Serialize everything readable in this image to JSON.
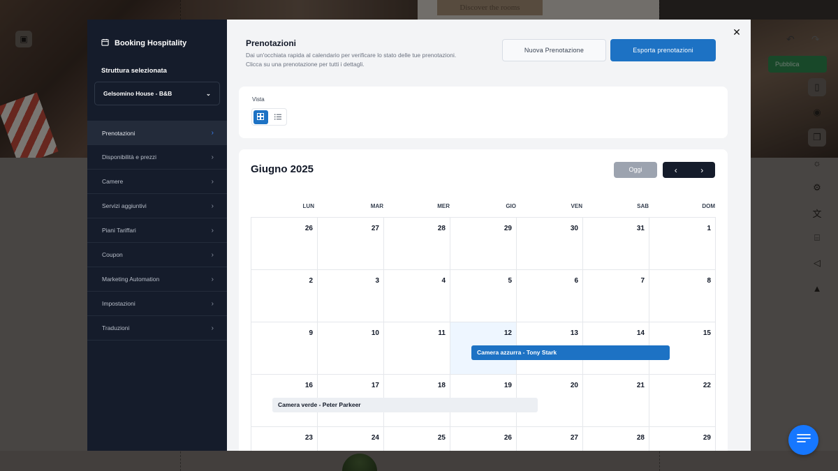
{
  "background": {
    "hero_cta": "Discover the rooms",
    "publish_label": "Pubblica"
  },
  "sidebar": {
    "title": "Booking Hospitality",
    "structure_label": "Struttura selezionata",
    "selected_property": "Gelsomino House - B&B",
    "items": [
      {
        "label": "Prenotazioni",
        "active": true
      },
      {
        "label": "Disponibilità e prezzi"
      },
      {
        "label": "Camere"
      },
      {
        "label": "Servizi aggiuntivi"
      },
      {
        "label": "Piani Tariffari"
      },
      {
        "label": "Coupon"
      },
      {
        "label": "Marketing Automation"
      },
      {
        "label": "Impostazioni"
      },
      {
        "label": "Traduzioni"
      }
    ]
  },
  "main": {
    "title": "Prenotazioni",
    "description_line1": "Dai un'occhiata rapida al calendario per verificare lo stato delle tue prenotazioni.",
    "description_line2": "Clicca su una prenotazione per tutti i dettagli.",
    "new_booking_label": "Nuova Prenotazione",
    "export_label": "Esporta prenotazioni"
  },
  "view": {
    "label": "Vista",
    "selected": "calendar"
  },
  "calendar": {
    "month_title": "Giugno 2025",
    "today_label": "Oggi",
    "weekdays": [
      "LUN",
      "MAR",
      "MER",
      "GIO",
      "VEN",
      "SAB",
      "DOM"
    ],
    "weeks": [
      [
        "26",
        "27",
        "28",
        "29",
        "30",
        "31",
        "1"
      ],
      [
        "2",
        "3",
        "4",
        "5",
        "6",
        "7",
        "8"
      ],
      [
        "9",
        "10",
        "11",
        "12",
        "13",
        "14",
        "15"
      ],
      [
        "16",
        "17",
        "18",
        "19",
        "20",
        "21",
        "22"
      ],
      [
        "23",
        "24",
        "25",
        "26",
        "27",
        "28",
        "29"
      ]
    ],
    "today": "12",
    "events": [
      {
        "label": "Camera azzurra - Tony Stark",
        "color": "#1d72c4"
      },
      {
        "label": "Camera verde - Peter Parkeer",
        "color": "#eceff3"
      }
    ]
  },
  "colors": {
    "sidebar_bg": "#151c2b",
    "accent": "#1d72c4",
    "today_bg": "#eef6ff"
  }
}
